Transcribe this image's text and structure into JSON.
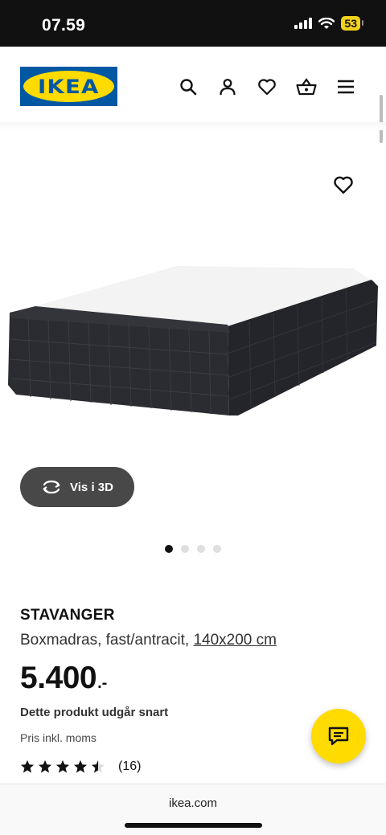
{
  "status_bar": {
    "time": "07.59",
    "battery": "53"
  },
  "header": {
    "logo_text": "IKEA"
  },
  "product": {
    "name": "STAVANGER",
    "description": "Boxmadras, fast/antracit,",
    "size": "140x200 cm",
    "price": "5.400",
    "price_suffix": ".-",
    "availability": "Dette produkt udgår snart",
    "vat_note": "Pris inkl. moms",
    "rating_value": 4.5,
    "rating_count": "(16)"
  },
  "gallery": {
    "view_3d_label": "Vis i 3D",
    "image_count": 4,
    "active_index": 0
  },
  "browser": {
    "url": "ikea.com"
  },
  "colors": {
    "ikea_blue": "#0058a3",
    "ikea_yellow": "#ffdb00",
    "product_fabric": "#2b2c31"
  }
}
